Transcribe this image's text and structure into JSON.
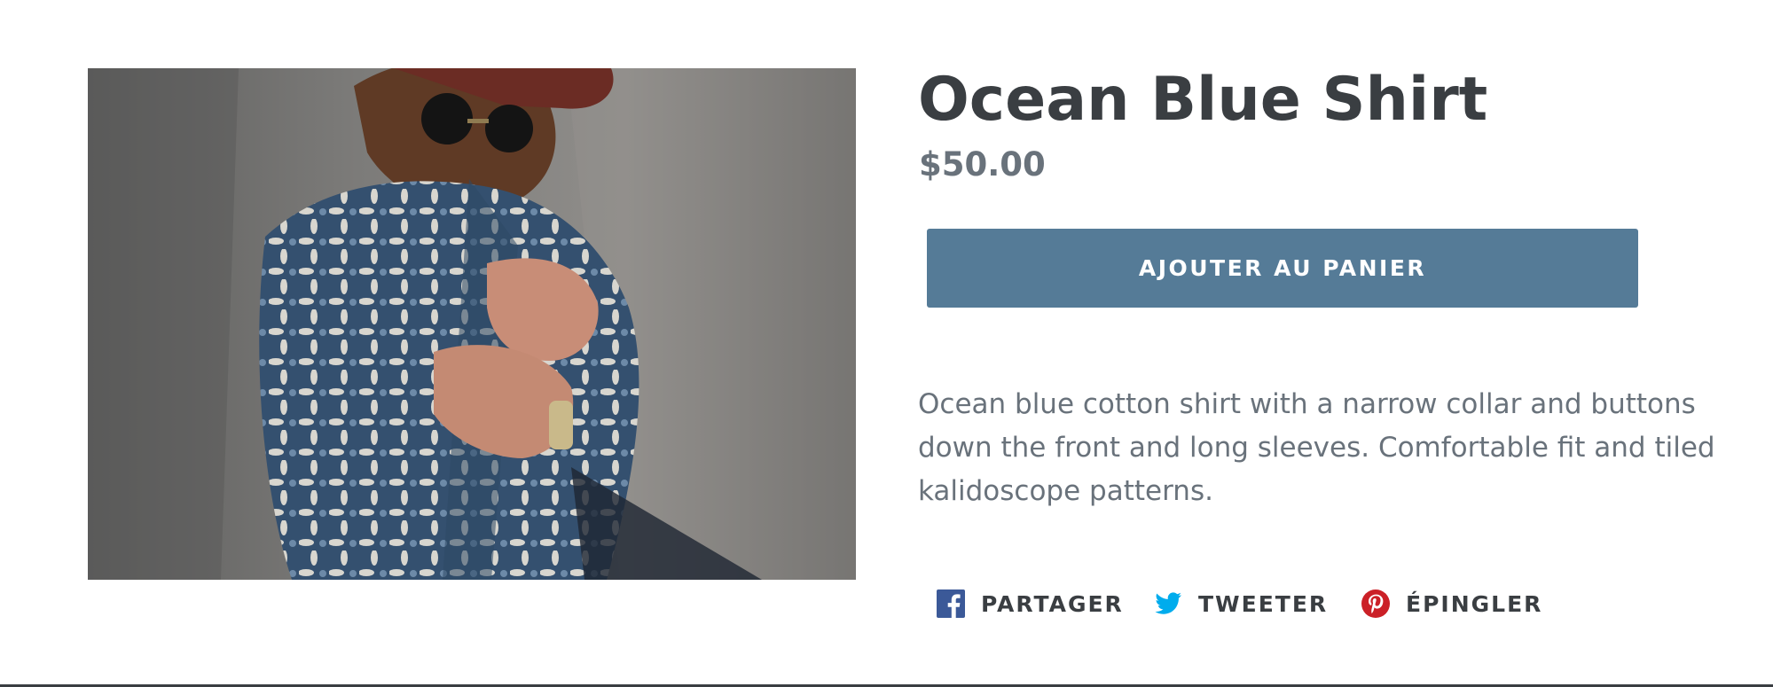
{
  "product": {
    "title": "Ocean Blue Shirt",
    "price": "$50.00",
    "add_to_cart_label": "AJOUTER AU PANIER",
    "description": "Ocean blue cotton shirt with a narrow collar and buttons down the front and long sleeves. Comfortable fit and tiled kalidoscope patterns.",
    "image": {
      "icon": "product-photo-man-in-patterned-shirt"
    }
  },
  "social_sharing": {
    "items": [
      {
        "label": "PARTAGER",
        "icon": "facebook-icon",
        "color": "#3b5998"
      },
      {
        "label": "TWEETER",
        "icon": "twitter-icon",
        "color": "#00aced"
      },
      {
        "label": "ÉPINGLER",
        "icon": "pinterest-icon",
        "color": "#cb2027"
      }
    ]
  },
  "colors": {
    "button_background": "#557b97",
    "button_text": "#ffffff",
    "title_text": "#3a3e42",
    "body_text": "#69727b"
  }
}
